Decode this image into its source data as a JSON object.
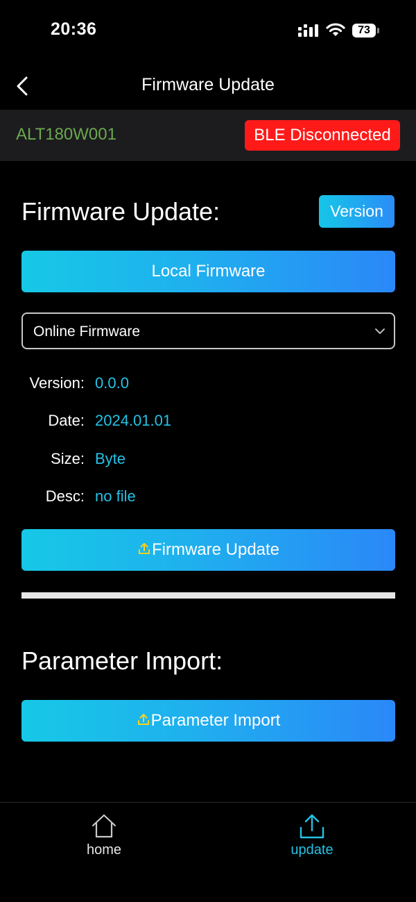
{
  "status_bar": {
    "time": "20:36",
    "battery": "73",
    "icons": [
      "signal-icon",
      "wifi-icon",
      "battery-icon"
    ]
  },
  "nav": {
    "title": "Firmware Update",
    "back_icon": "chevron-left-icon"
  },
  "device": {
    "name": "ALT180W001",
    "ble_status": "BLE Disconnected",
    "ble_status_color": "#ff1a1a",
    "name_color": "#6aa84f"
  },
  "firmware": {
    "heading": "Firmware Update:",
    "version_button": "Version",
    "local_button": "Local Firmware",
    "online_select": {
      "selected": "Online Firmware"
    },
    "info": [
      {
        "label": "Version:",
        "value": "0.0.0"
      },
      {
        "label": "Date:",
        "value": "2024.01.01"
      },
      {
        "label": "Size:",
        "value": "Byte"
      },
      {
        "label": "Desc:",
        "value": "no file"
      }
    ],
    "update_button": "Firmware Update"
  },
  "parameter": {
    "heading": "Parameter Import:",
    "import_button": "Parameter Import"
  },
  "tabs": [
    {
      "label": "home",
      "icon": "home-icon",
      "active": false
    },
    {
      "label": "update",
      "icon": "upload-icon",
      "active": true
    }
  ],
  "colors": {
    "accent": "#25c2e6",
    "gradient_start": "#16c8e6",
    "gradient_end": "#2a88f8",
    "upload_glyph": "#ffd21a"
  }
}
